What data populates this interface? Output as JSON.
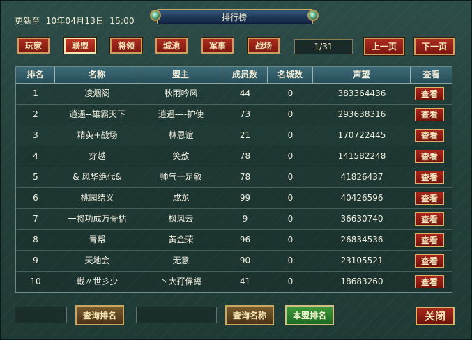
{
  "window": {
    "title": "排行榜",
    "update_label": "更新至",
    "update_date": "10年04月13日",
    "update_time": "15:00"
  },
  "tabs": [
    {
      "label": "玩家",
      "active": false
    },
    {
      "label": "联盟",
      "active": true
    },
    {
      "label": "将领",
      "active": false
    },
    {
      "label": "城池",
      "active": false
    },
    {
      "label": "军事",
      "active": false
    },
    {
      "label": "战场",
      "active": false
    }
  ],
  "pagination": {
    "page": "1/31",
    "prev_label": "上一页",
    "next_label": "下一页"
  },
  "table": {
    "headers": [
      "排名",
      "名称",
      "盟主",
      "成员数",
      "名城数",
      "声望",
      "查看"
    ],
    "view_label": "查看",
    "rows": [
      {
        "rank": "1",
        "name": "凌烟阁",
        "leader": "秋雨吟风",
        "members": "44",
        "cities": "0",
        "prestige": "383364436"
      },
      {
        "rank": "2",
        "name": "逍遥--雄霸天下",
        "leader": "逍遥----护使",
        "members": "73",
        "cities": "0",
        "prestige": "293638316"
      },
      {
        "rank": "3",
        "name": "精英+战场",
        "leader": "林恩谊",
        "members": "21",
        "cities": "0",
        "prestige": "170722445"
      },
      {
        "rank": "4",
        "name": "穿越",
        "leader": "笑敖",
        "members": "78",
        "cities": "0",
        "prestige": "141582248"
      },
      {
        "rank": "5",
        "name": "& 风华绝代&",
        "leader": "帅气十足敏",
        "members": "78",
        "cities": "0",
        "prestige": "41826437"
      },
      {
        "rank": "6",
        "name": "桃园结义",
        "leader": "成龙",
        "members": "99",
        "cities": "0",
        "prestige": "40426596"
      },
      {
        "rank": "7",
        "name": "一将功成万骨枯",
        "leader": "枫风云",
        "members": "9",
        "cities": "0",
        "prestige": "36630740"
      },
      {
        "rank": "8",
        "name": "青帮",
        "leader": "黄金荣",
        "members": "96",
        "cities": "0",
        "prestige": "26834536"
      },
      {
        "rank": "9",
        "name": "天地会",
        "leader": "无意",
        "members": "90",
        "cities": "0",
        "prestige": "23105521"
      },
      {
        "rank": "10",
        "name": "戦〃世彡少",
        "leader": "丶大孖偉總",
        "members": "41",
        "cities": "0",
        "prestige": "18683260"
      }
    ]
  },
  "bottom": {
    "rank_query_value": "",
    "rank_query_label": "查询排名",
    "name_query_value": "",
    "name_query_label": "查询名称",
    "my_rank_label": "本盟排名",
    "close_label": "关闭"
  }
}
